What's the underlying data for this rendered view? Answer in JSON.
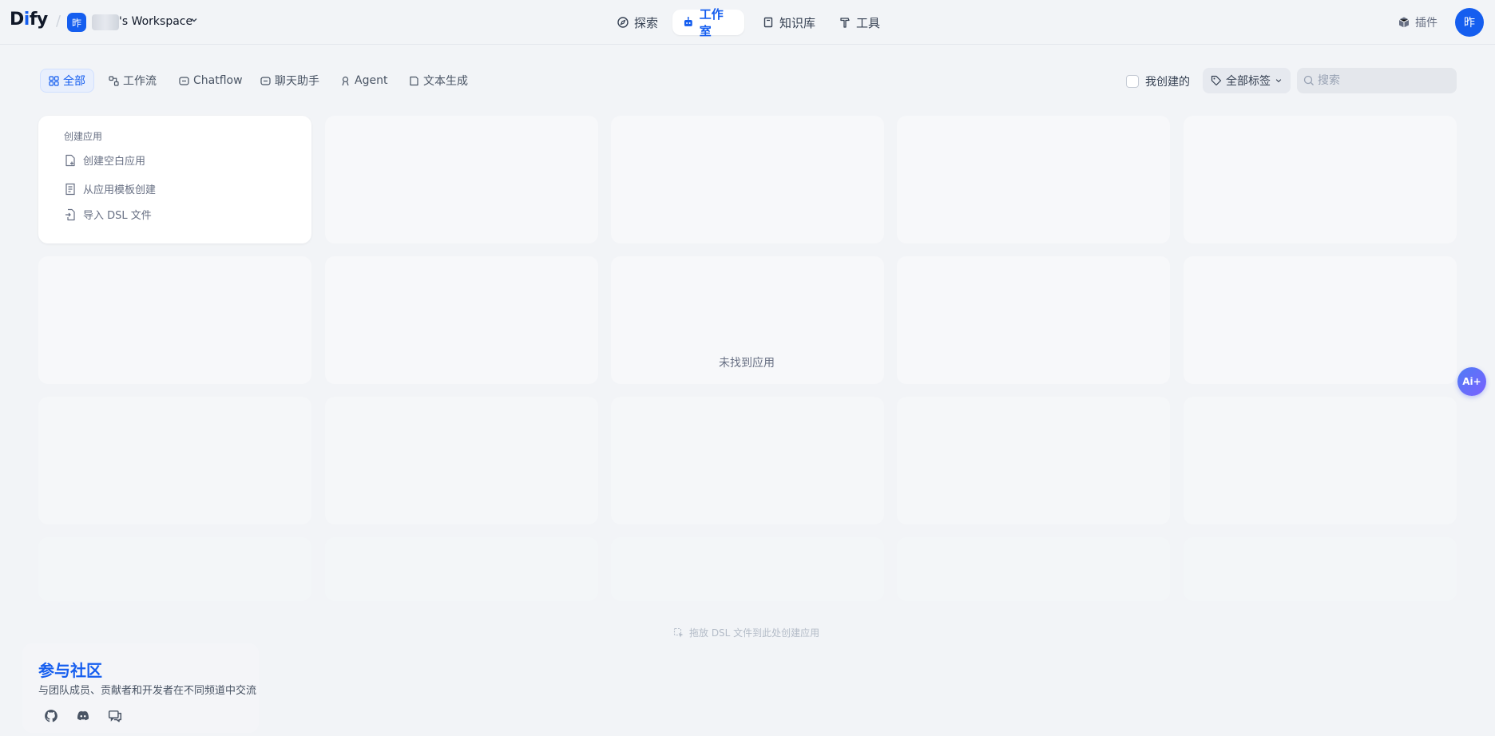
{
  "header": {
    "logo": {
      "pre": "D",
      "i": "i",
      "post": "fy"
    },
    "workspace": {
      "avatar": "昨",
      "name": "'s Workspace"
    },
    "nav": [
      {
        "label": "探索",
        "icon": "compass-icon"
      },
      {
        "label": "工作室",
        "icon": "robot-icon",
        "active": true
      },
      {
        "label": "知识库",
        "icon": "book-icon"
      },
      {
        "label": "工具",
        "icon": "hammer-icon"
      }
    ],
    "plugins": "插件",
    "user_avatar": "昨"
  },
  "filters": {
    "tabs": [
      {
        "label": "全部",
        "active": true
      },
      {
        "label": "工作流"
      },
      {
        "label": "Chatflow"
      },
      {
        "label": "聊天助手"
      },
      {
        "label": "Agent"
      },
      {
        "label": "文本生成"
      }
    ],
    "created_by_me": "我创建的",
    "tags": "全部标签",
    "search_placeholder": "搜索"
  },
  "create_card": {
    "title": "创建应用",
    "items": [
      "创建空白应用",
      "从应用模板创建",
      "导入 DSL 文件"
    ]
  },
  "empty": "未找到应用",
  "dsl_hint": "拖放 DSL 文件到此处创建应用",
  "ai_button": "Ai+",
  "community": {
    "title": "参与社区",
    "desc": "与团队成员、贡献者和开发者在不同频道中交流"
  },
  "colors": {
    "accent": "#155eef",
    "background": "#f2f4f7"
  }
}
